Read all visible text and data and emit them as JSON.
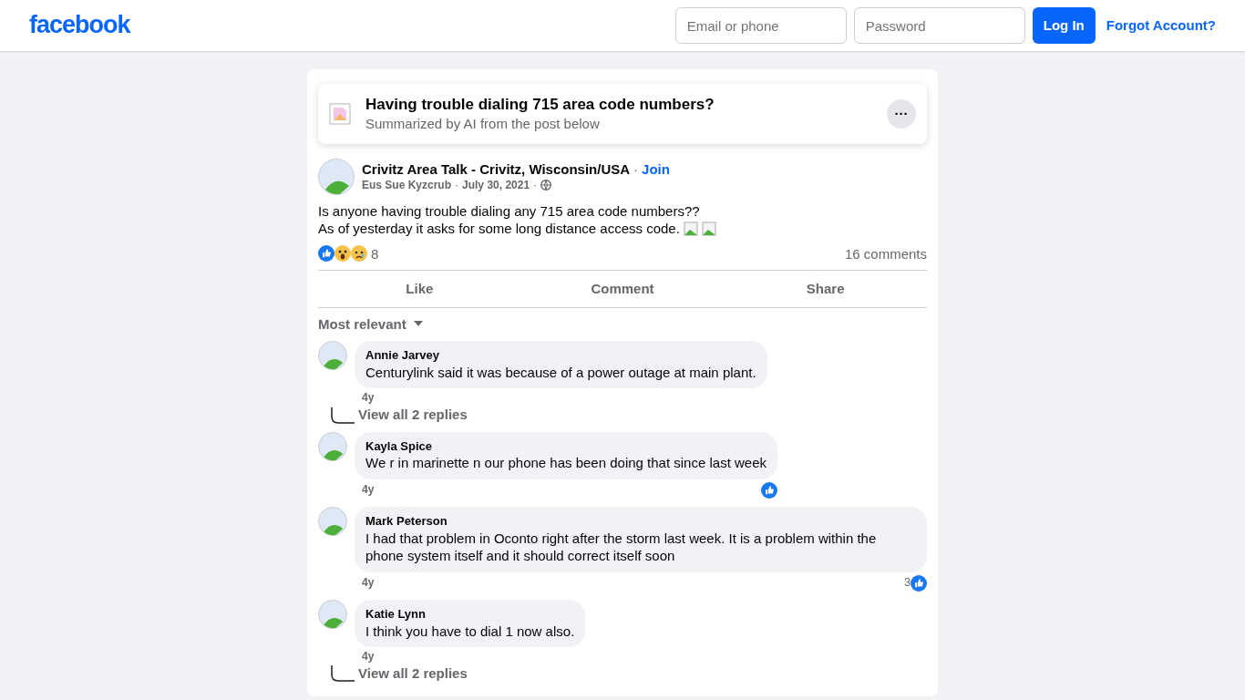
{
  "header": {
    "logo": "facebook",
    "email": {
      "placeholder": "Email or phone"
    },
    "password": {
      "placeholder": "Password"
    },
    "login": "Log In",
    "forgot": "Forgot Account?"
  },
  "summary": {
    "title": "Having trouble dialing 715 area code numbers?",
    "subtitle": "Summarized by AI from the post below",
    "more": "···"
  },
  "post": {
    "group": "Crivitz Area Talk - Crivitz, Wisconsin/USA",
    "separator": "·",
    "join": "Join",
    "author": "Eus Sue Kyzcrub",
    "date": "July 30, 2021",
    "lines": [
      "Is anyone having trouble dialing any 715 area code numbers??",
      "As of yesterday it asks for some long distance access code."
    ],
    "reaction_count": "8",
    "comments_count": "16 comments",
    "actions": [
      "Like",
      "Comment",
      "Share"
    ],
    "sort": "Most relevant"
  },
  "comments": [
    {
      "name": "Annie Jarvey",
      "text": "Centurylink said it was because of a power outage at main plant.",
      "time": "4y",
      "reacted": false,
      "replies": "View all 2 replies"
    },
    {
      "name": "Kayla Spice",
      "text": "We r in marinette n our phone has been doing that since last week",
      "time": "4y",
      "reacted": true
    },
    {
      "name": "Mark Peterson",
      "text": "I had that problem in Oconto right after the storm last week. It is a problem within the phone system itself and it should correct itself soon",
      "time": "4y",
      "reacted": true,
      "likes": "3"
    },
    {
      "name": "Katie Lynn",
      "text": "I think you have to dial 1 now also.",
      "time": "4y",
      "reacted": false,
      "replies": "View all 2 replies"
    }
  ]
}
